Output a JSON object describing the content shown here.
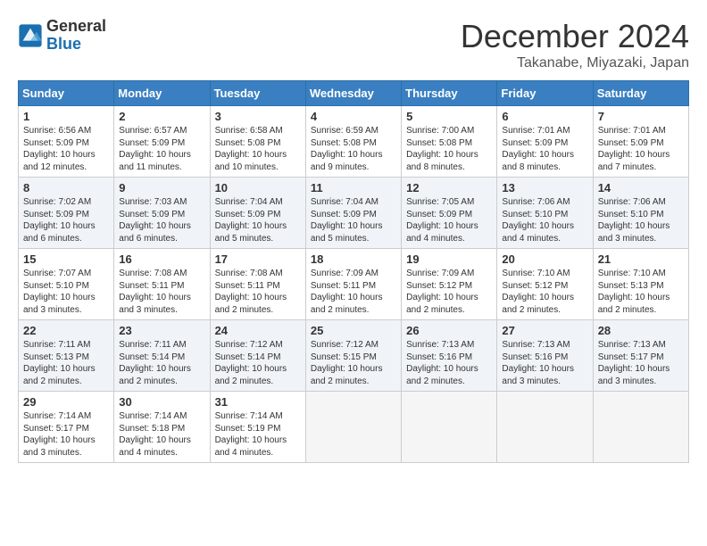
{
  "logo": {
    "general": "General",
    "blue": "Blue"
  },
  "title": "December 2024",
  "location": "Takanabe, Miyazaki, Japan",
  "days_of_week": [
    "Sunday",
    "Monday",
    "Tuesday",
    "Wednesday",
    "Thursday",
    "Friday",
    "Saturday"
  ],
  "weeks": [
    [
      {
        "day": "1",
        "sunrise": "6:56 AM",
        "sunset": "5:09 PM",
        "daylight": "10 hours and 12 minutes."
      },
      {
        "day": "2",
        "sunrise": "6:57 AM",
        "sunset": "5:09 PM",
        "daylight": "10 hours and 11 minutes."
      },
      {
        "day": "3",
        "sunrise": "6:58 AM",
        "sunset": "5:08 PM",
        "daylight": "10 hours and 10 minutes."
      },
      {
        "day": "4",
        "sunrise": "6:59 AM",
        "sunset": "5:08 PM",
        "daylight": "10 hours and 9 minutes."
      },
      {
        "day": "5",
        "sunrise": "7:00 AM",
        "sunset": "5:08 PM",
        "daylight": "10 hours and 8 minutes."
      },
      {
        "day": "6",
        "sunrise": "7:01 AM",
        "sunset": "5:09 PM",
        "daylight": "10 hours and 8 minutes."
      },
      {
        "day": "7",
        "sunrise": "7:01 AM",
        "sunset": "5:09 PM",
        "daylight": "10 hours and 7 minutes."
      }
    ],
    [
      {
        "day": "8",
        "sunrise": "7:02 AM",
        "sunset": "5:09 PM",
        "daylight": "10 hours and 6 minutes."
      },
      {
        "day": "9",
        "sunrise": "7:03 AM",
        "sunset": "5:09 PM",
        "daylight": "10 hours and 6 minutes."
      },
      {
        "day": "10",
        "sunrise": "7:04 AM",
        "sunset": "5:09 PM",
        "daylight": "10 hours and 5 minutes."
      },
      {
        "day": "11",
        "sunrise": "7:04 AM",
        "sunset": "5:09 PM",
        "daylight": "10 hours and 5 minutes."
      },
      {
        "day": "12",
        "sunrise": "7:05 AM",
        "sunset": "5:09 PM",
        "daylight": "10 hours and 4 minutes."
      },
      {
        "day": "13",
        "sunrise": "7:06 AM",
        "sunset": "5:10 PM",
        "daylight": "10 hours and 4 minutes."
      },
      {
        "day": "14",
        "sunrise": "7:06 AM",
        "sunset": "5:10 PM",
        "daylight": "10 hours and 3 minutes."
      }
    ],
    [
      {
        "day": "15",
        "sunrise": "7:07 AM",
        "sunset": "5:10 PM",
        "daylight": "10 hours and 3 minutes."
      },
      {
        "day": "16",
        "sunrise": "7:08 AM",
        "sunset": "5:11 PM",
        "daylight": "10 hours and 3 minutes."
      },
      {
        "day": "17",
        "sunrise": "7:08 AM",
        "sunset": "5:11 PM",
        "daylight": "10 hours and 2 minutes."
      },
      {
        "day": "18",
        "sunrise": "7:09 AM",
        "sunset": "5:11 PM",
        "daylight": "10 hours and 2 minutes."
      },
      {
        "day": "19",
        "sunrise": "7:09 AM",
        "sunset": "5:12 PM",
        "daylight": "10 hours and 2 minutes."
      },
      {
        "day": "20",
        "sunrise": "7:10 AM",
        "sunset": "5:12 PM",
        "daylight": "10 hours and 2 minutes."
      },
      {
        "day": "21",
        "sunrise": "7:10 AM",
        "sunset": "5:13 PM",
        "daylight": "10 hours and 2 minutes."
      }
    ],
    [
      {
        "day": "22",
        "sunrise": "7:11 AM",
        "sunset": "5:13 PM",
        "daylight": "10 hours and 2 minutes."
      },
      {
        "day": "23",
        "sunrise": "7:11 AM",
        "sunset": "5:14 PM",
        "daylight": "10 hours and 2 minutes."
      },
      {
        "day": "24",
        "sunrise": "7:12 AM",
        "sunset": "5:14 PM",
        "daylight": "10 hours and 2 minutes."
      },
      {
        "day": "25",
        "sunrise": "7:12 AM",
        "sunset": "5:15 PM",
        "daylight": "10 hours and 2 minutes."
      },
      {
        "day": "26",
        "sunrise": "7:13 AM",
        "sunset": "5:16 PM",
        "daylight": "10 hours and 2 minutes."
      },
      {
        "day": "27",
        "sunrise": "7:13 AM",
        "sunset": "5:16 PM",
        "daylight": "10 hours and 3 minutes."
      },
      {
        "day": "28",
        "sunrise": "7:13 AM",
        "sunset": "5:17 PM",
        "daylight": "10 hours and 3 minutes."
      }
    ],
    [
      {
        "day": "29",
        "sunrise": "7:14 AM",
        "sunset": "5:17 PM",
        "daylight": "10 hours and 3 minutes."
      },
      {
        "day": "30",
        "sunrise": "7:14 AM",
        "sunset": "5:18 PM",
        "daylight": "10 hours and 4 minutes."
      },
      {
        "day": "31",
        "sunrise": "7:14 AM",
        "sunset": "5:19 PM",
        "daylight": "10 hours and 4 minutes."
      },
      null,
      null,
      null,
      null
    ]
  ]
}
